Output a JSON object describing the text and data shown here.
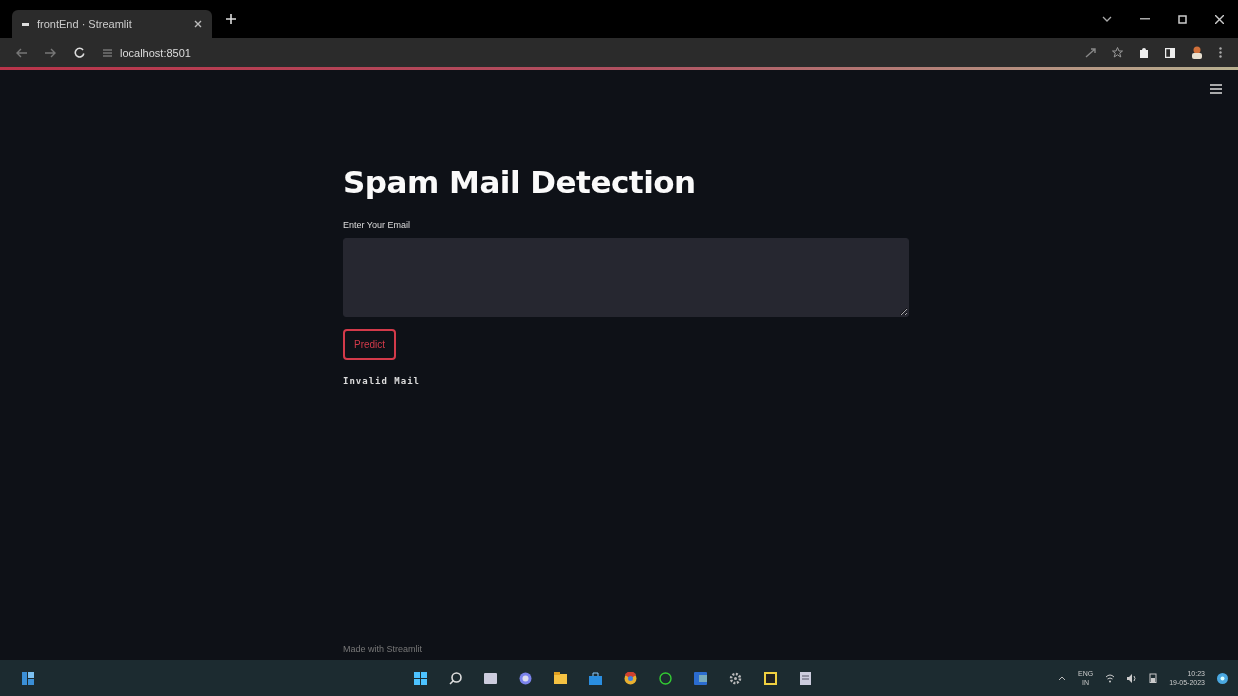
{
  "browser": {
    "tab_title": "frontEnd · Streamlit",
    "url": "localhost:8501"
  },
  "app": {
    "title": "Spam Mail Detection",
    "field_label": "Enter Your Email",
    "button": "Predict",
    "result": "Invalid Mail",
    "footer": "Made with Streamlit"
  },
  "taskbar": {
    "language": "ENG",
    "region": "IN",
    "time": "10:23",
    "date": "19-05-2023"
  }
}
